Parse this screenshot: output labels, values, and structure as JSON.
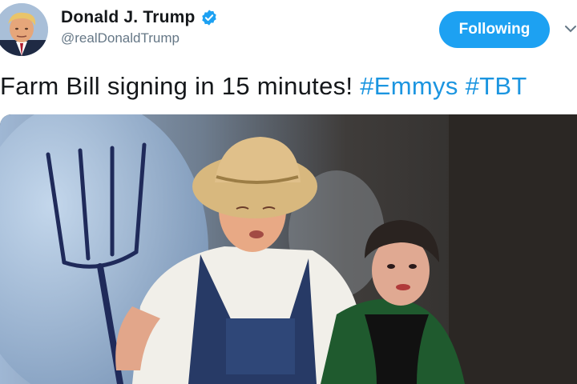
{
  "author": {
    "display_name": "Donald J. Trump",
    "handle": "@realDonaldTrump",
    "verified": true,
    "avatar_icon": "profile-photo"
  },
  "follow_button": {
    "label": "Following",
    "color": "#1da1f2"
  },
  "menu_icon": "chevron-down-icon",
  "tweet": {
    "text": "Farm Bill signing in 15 minutes!",
    "hashtags": [
      "#Emmys",
      "#TBT"
    ]
  },
  "media": {
    "type": "video-still",
    "subject": "performer in straw hat and overalls holding pitchfork, woman in fur coat beside him"
  },
  "colors": {
    "link": "#1b95e0",
    "text": "#14171a",
    "secondary_text": "#657786"
  }
}
